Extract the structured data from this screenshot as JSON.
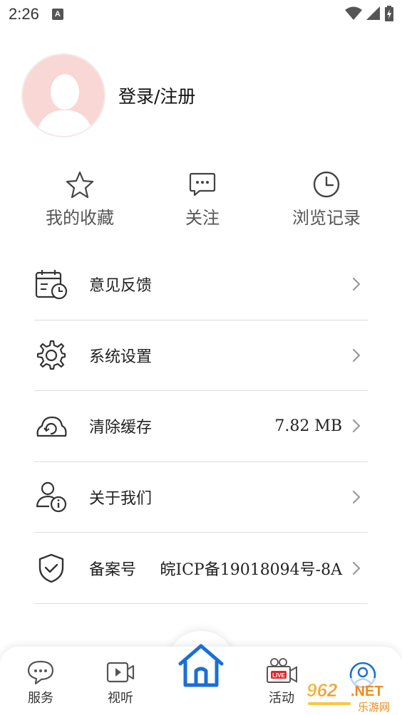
{
  "status": {
    "time": "2:26",
    "notif_letter": "A"
  },
  "profile": {
    "login_label": "登录/注册"
  },
  "quick_actions": [
    {
      "label": "我的收藏",
      "icon": "star-icon"
    },
    {
      "label": "关注",
      "icon": "chat-bubble-icon"
    },
    {
      "label": "浏览记录",
      "icon": "clock-icon"
    }
  ],
  "menu": [
    {
      "label": "意见反馈",
      "value": "",
      "icon": "calendar-clock-icon"
    },
    {
      "label": "系统设置",
      "value": "",
      "icon": "gear-icon"
    },
    {
      "label": "清除缓存",
      "value": "7.82 MB",
      "icon": "cloud-refresh-icon"
    },
    {
      "label": "关于我们",
      "value": "",
      "icon": "user-info-icon"
    },
    {
      "label": "备案号",
      "value": "皖ICP备19018094号-8A",
      "icon": "shield-check-icon"
    }
  ],
  "tabbar": {
    "service": "服务",
    "video": "视听",
    "activity": "活动",
    "home_icon": "home-icon",
    "accent": "#1a6fd6"
  },
  "watermark": {
    "brand": "962.NET",
    "sub": "乐游网"
  }
}
